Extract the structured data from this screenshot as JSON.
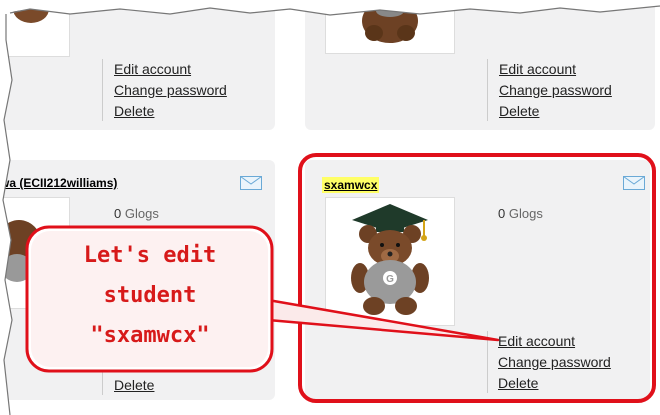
{
  "cards": [
    {
      "username": "",
      "edit_label": "Edit account",
      "change_password_label": "Change password",
      "delete_label": "Delete"
    },
    {
      "username": "",
      "edit_label": "Edit account",
      "change_password_label": "Change password",
      "delete_label": "Delete"
    },
    {
      "username": "wa (ECII212williams)",
      "glogs_count": "0",
      "glogs_label": "Glogs",
      "delete_label": "Delete"
    },
    {
      "username": "sxamwcx",
      "glogs_count": "0",
      "glogs_label": "Glogs",
      "edit_label": "Edit account",
      "change_password_label": "Change password",
      "delete_label": "Delete"
    }
  ],
  "callout": {
    "line1": "Let's edit",
    "line2": "student",
    "line3": "\"sxamwcx\""
  },
  "colors": {
    "highlight_red": "#e0101a",
    "callout_text": "#d71a1a",
    "username_highlight": "#ffff66"
  },
  "icons": {
    "mail": "envelope-icon",
    "avatar": "graduation-bear-avatar"
  }
}
